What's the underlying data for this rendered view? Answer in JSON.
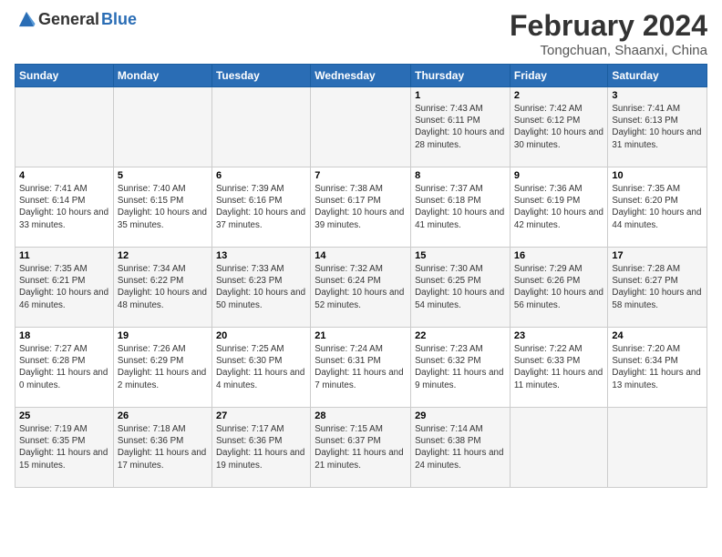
{
  "header": {
    "logo_general": "General",
    "logo_blue": "Blue",
    "month": "February 2024",
    "location": "Tongchuan, Shaanxi, China"
  },
  "weekdays": [
    "Sunday",
    "Monday",
    "Tuesday",
    "Wednesday",
    "Thursday",
    "Friday",
    "Saturday"
  ],
  "weeks": [
    [
      {
        "day": "",
        "sunrise": "",
        "sunset": "",
        "daylight": ""
      },
      {
        "day": "",
        "sunrise": "",
        "sunset": "",
        "daylight": ""
      },
      {
        "day": "",
        "sunrise": "",
        "sunset": "",
        "daylight": ""
      },
      {
        "day": "",
        "sunrise": "",
        "sunset": "",
        "daylight": ""
      },
      {
        "day": "1",
        "sunrise": "Sunrise: 7:43 AM",
        "sunset": "Sunset: 6:11 PM",
        "daylight": "Daylight: 10 hours and 28 minutes."
      },
      {
        "day": "2",
        "sunrise": "Sunrise: 7:42 AM",
        "sunset": "Sunset: 6:12 PM",
        "daylight": "Daylight: 10 hours and 30 minutes."
      },
      {
        "day": "3",
        "sunrise": "Sunrise: 7:41 AM",
        "sunset": "Sunset: 6:13 PM",
        "daylight": "Daylight: 10 hours and 31 minutes."
      }
    ],
    [
      {
        "day": "4",
        "sunrise": "Sunrise: 7:41 AM",
        "sunset": "Sunset: 6:14 PM",
        "daylight": "Daylight: 10 hours and 33 minutes."
      },
      {
        "day": "5",
        "sunrise": "Sunrise: 7:40 AM",
        "sunset": "Sunset: 6:15 PM",
        "daylight": "Daylight: 10 hours and 35 minutes."
      },
      {
        "day": "6",
        "sunrise": "Sunrise: 7:39 AM",
        "sunset": "Sunset: 6:16 PM",
        "daylight": "Daylight: 10 hours and 37 minutes."
      },
      {
        "day": "7",
        "sunrise": "Sunrise: 7:38 AM",
        "sunset": "Sunset: 6:17 PM",
        "daylight": "Daylight: 10 hours and 39 minutes."
      },
      {
        "day": "8",
        "sunrise": "Sunrise: 7:37 AM",
        "sunset": "Sunset: 6:18 PM",
        "daylight": "Daylight: 10 hours and 41 minutes."
      },
      {
        "day": "9",
        "sunrise": "Sunrise: 7:36 AM",
        "sunset": "Sunset: 6:19 PM",
        "daylight": "Daylight: 10 hours and 42 minutes."
      },
      {
        "day": "10",
        "sunrise": "Sunrise: 7:35 AM",
        "sunset": "Sunset: 6:20 PM",
        "daylight": "Daylight: 10 hours and 44 minutes."
      }
    ],
    [
      {
        "day": "11",
        "sunrise": "Sunrise: 7:35 AM",
        "sunset": "Sunset: 6:21 PM",
        "daylight": "Daylight: 10 hours and 46 minutes."
      },
      {
        "day": "12",
        "sunrise": "Sunrise: 7:34 AM",
        "sunset": "Sunset: 6:22 PM",
        "daylight": "Daylight: 10 hours and 48 minutes."
      },
      {
        "day": "13",
        "sunrise": "Sunrise: 7:33 AM",
        "sunset": "Sunset: 6:23 PM",
        "daylight": "Daylight: 10 hours and 50 minutes."
      },
      {
        "day": "14",
        "sunrise": "Sunrise: 7:32 AM",
        "sunset": "Sunset: 6:24 PM",
        "daylight": "Daylight: 10 hours and 52 minutes."
      },
      {
        "day": "15",
        "sunrise": "Sunrise: 7:30 AM",
        "sunset": "Sunset: 6:25 PM",
        "daylight": "Daylight: 10 hours and 54 minutes."
      },
      {
        "day": "16",
        "sunrise": "Sunrise: 7:29 AM",
        "sunset": "Sunset: 6:26 PM",
        "daylight": "Daylight: 10 hours and 56 minutes."
      },
      {
        "day": "17",
        "sunrise": "Sunrise: 7:28 AM",
        "sunset": "Sunset: 6:27 PM",
        "daylight": "Daylight: 10 hours and 58 minutes."
      }
    ],
    [
      {
        "day": "18",
        "sunrise": "Sunrise: 7:27 AM",
        "sunset": "Sunset: 6:28 PM",
        "daylight": "Daylight: 11 hours and 0 minutes."
      },
      {
        "day": "19",
        "sunrise": "Sunrise: 7:26 AM",
        "sunset": "Sunset: 6:29 PM",
        "daylight": "Daylight: 11 hours and 2 minutes."
      },
      {
        "day": "20",
        "sunrise": "Sunrise: 7:25 AM",
        "sunset": "Sunset: 6:30 PM",
        "daylight": "Daylight: 11 hours and 4 minutes."
      },
      {
        "day": "21",
        "sunrise": "Sunrise: 7:24 AM",
        "sunset": "Sunset: 6:31 PM",
        "daylight": "Daylight: 11 hours and 7 minutes."
      },
      {
        "day": "22",
        "sunrise": "Sunrise: 7:23 AM",
        "sunset": "Sunset: 6:32 PM",
        "daylight": "Daylight: 11 hours and 9 minutes."
      },
      {
        "day": "23",
        "sunrise": "Sunrise: 7:22 AM",
        "sunset": "Sunset: 6:33 PM",
        "daylight": "Daylight: 11 hours and 11 minutes."
      },
      {
        "day": "24",
        "sunrise": "Sunrise: 7:20 AM",
        "sunset": "Sunset: 6:34 PM",
        "daylight": "Daylight: 11 hours and 13 minutes."
      }
    ],
    [
      {
        "day": "25",
        "sunrise": "Sunrise: 7:19 AM",
        "sunset": "Sunset: 6:35 PM",
        "daylight": "Daylight: 11 hours and 15 minutes."
      },
      {
        "day": "26",
        "sunrise": "Sunrise: 7:18 AM",
        "sunset": "Sunset: 6:36 PM",
        "daylight": "Daylight: 11 hours and 17 minutes."
      },
      {
        "day": "27",
        "sunrise": "Sunrise: 7:17 AM",
        "sunset": "Sunset: 6:36 PM",
        "daylight": "Daylight: 11 hours and 19 minutes."
      },
      {
        "day": "28",
        "sunrise": "Sunrise: 7:15 AM",
        "sunset": "Sunset: 6:37 PM",
        "daylight": "Daylight: 11 hours and 21 minutes."
      },
      {
        "day": "29",
        "sunrise": "Sunrise: 7:14 AM",
        "sunset": "Sunset: 6:38 PM",
        "daylight": "Daylight: 11 hours and 24 minutes."
      },
      {
        "day": "",
        "sunrise": "",
        "sunset": "",
        "daylight": ""
      },
      {
        "day": "",
        "sunrise": "",
        "sunset": "",
        "daylight": ""
      }
    ]
  ]
}
